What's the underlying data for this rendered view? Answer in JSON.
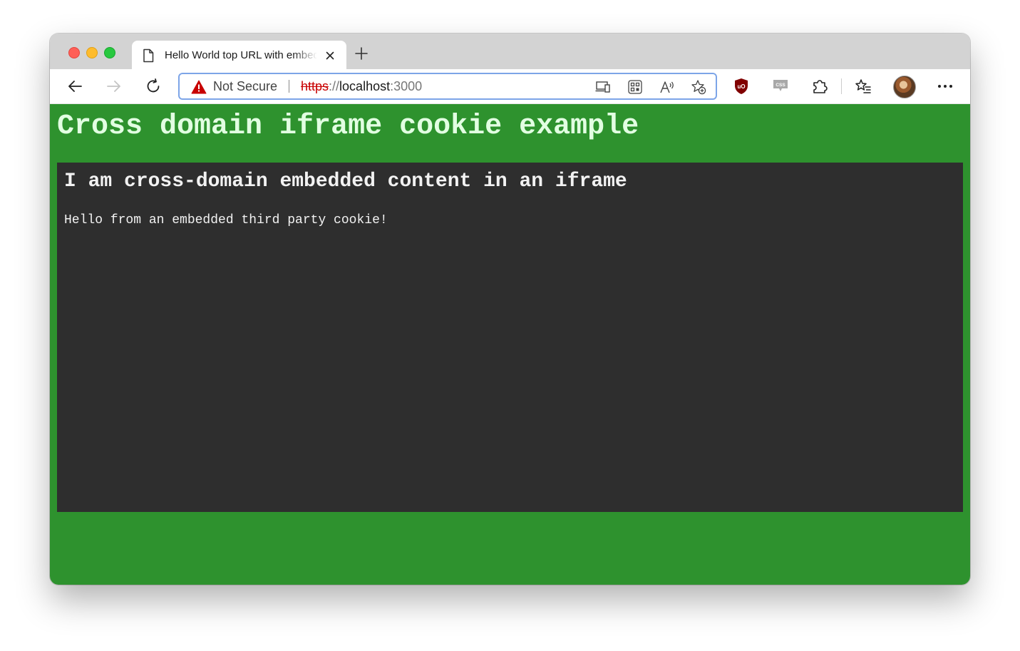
{
  "window": {
    "tab": {
      "title": "Hello World top URL with embedded iframe"
    }
  },
  "address_bar": {
    "security_label": "Not Secure",
    "url_scheme": "https",
    "url_separator": "://",
    "url_host": "localhost",
    "url_port": ":3000"
  },
  "icons": {
    "tab": "page-icon",
    "close": "close-icon",
    "new_tab": "plus-icon",
    "back": "back-arrow-icon",
    "forward": "forward-arrow-icon",
    "reload": "reload-icon",
    "warning": "warning-icon",
    "app_available": "app-available-icon",
    "qr": "qr-code-icon",
    "read_aloud": "read-aloud-icon",
    "add_favorite": "add-favorite-icon",
    "ublock": "ublock-origin-icon",
    "css_ext": "css-extension-icon",
    "extensions": "puzzle-icon",
    "favorites": "favorites-icon",
    "profile": "avatar",
    "menu": "more-icon"
  },
  "colors": {
    "page_background": "#2e922e",
    "heading_text": "#e2ffe2",
    "iframe_background": "#2e2e2e",
    "iframe_text": "#f2f2f2",
    "warning": "#c80000",
    "ublock": "#800000"
  },
  "page": {
    "heading": "Cross domain iframe cookie example",
    "iframe": {
      "heading": "I am cross-domain embedded content in an iframe",
      "text": "Hello from an embedded third party cookie!"
    }
  }
}
